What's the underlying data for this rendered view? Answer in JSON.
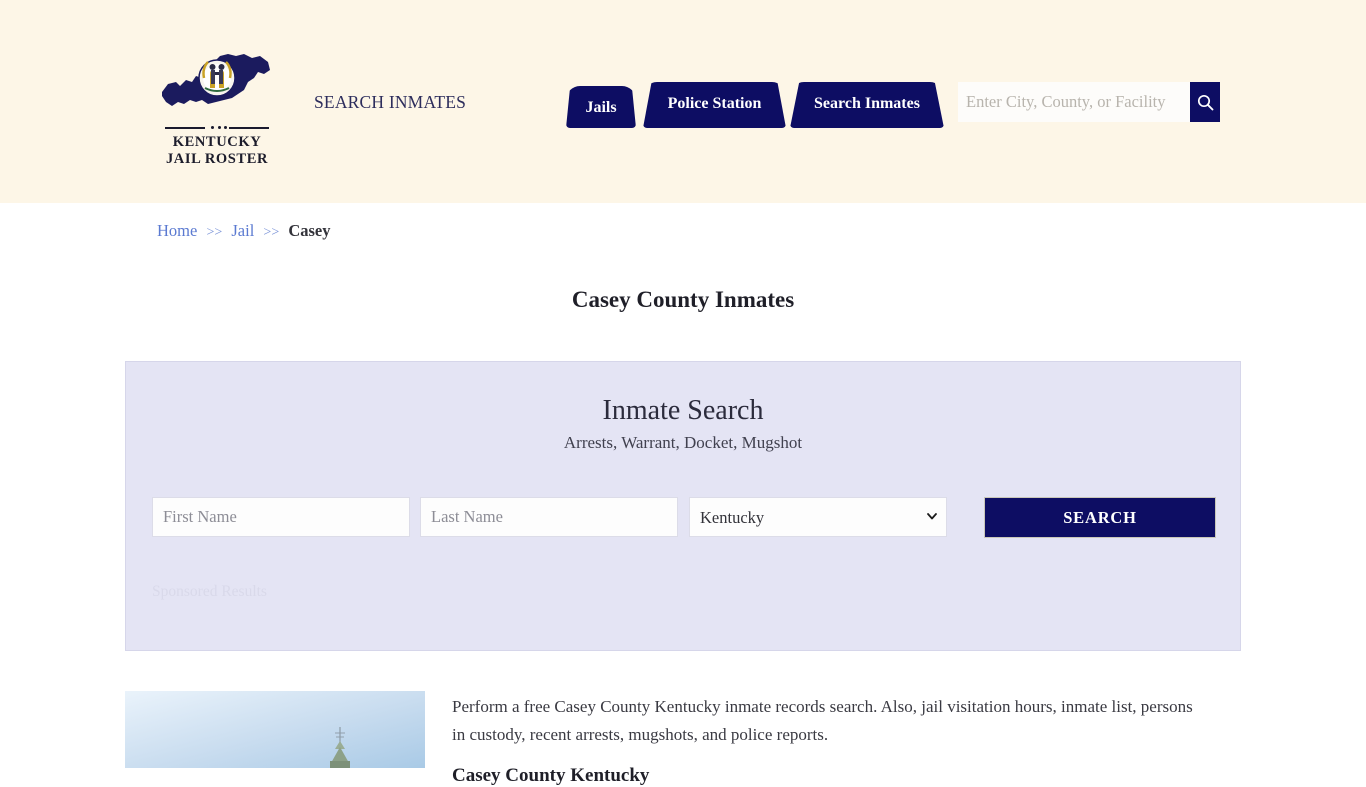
{
  "header": {
    "brand": {
      "line1": "KENTUCKY",
      "line2": "JAIL ROSTER",
      "map_icon": "kentucky-state-map-icon",
      "seal_icon": "kentucky-state-seal-icon"
    },
    "tagline": "SEARCH INMATES",
    "nav": [
      {
        "label": "Jails"
      },
      {
        "label": "Police Station"
      },
      {
        "label": "Search Inmates"
      }
    ],
    "search": {
      "placeholder": "Enter City, County, or Facility",
      "value": "",
      "button_icon": "search-icon"
    },
    "background_color": "#fdf6e7",
    "accent_color": "#0d0d63"
  },
  "breadcrumb": {
    "items": [
      {
        "label": "Home",
        "type": "link"
      },
      {
        "label": "Jail",
        "type": "link"
      },
      {
        "label": "Casey",
        "type": "current"
      }
    ],
    "separator": ">>",
    "link_color": "#5b7ad1"
  },
  "page": {
    "title": "Casey County Inmates"
  },
  "search_panel": {
    "title": "Inmate Search",
    "subtitle": "Arrests, Warrant, Docket, Mugshot",
    "background_color": "#e4e4f4",
    "fields": {
      "first_name_placeholder": "First Name",
      "first_name_value": "",
      "last_name_placeholder": "Last Name",
      "last_name_value": "",
      "state_selected": "Kentucky",
      "state_options": [
        "Kentucky"
      ]
    },
    "submit_label": "SEARCH",
    "sponsored_label": "Sponsored Results"
  },
  "content": {
    "thumbnail_alt": "casey-county-courthouse-photo",
    "paragraph": "Perform a free Casey County Kentucky inmate records search. Also, jail visitation hours, inmate list, persons in custody, recent arrests, mugshots, and police reports.",
    "heading": "Casey County Kentucky"
  }
}
